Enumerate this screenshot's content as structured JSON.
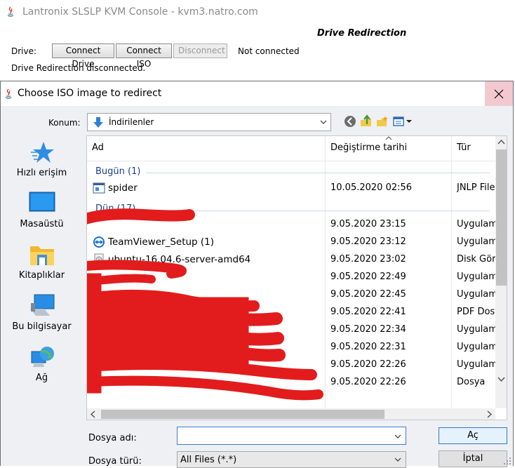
{
  "back_window": {
    "title": "Lantronix SLSLP KVM Console - kvm3.natro.com",
    "panel_title": "Drive Redirection",
    "drive_label": "Drive:",
    "buttons": {
      "connect_drive": "Connect Drive",
      "connect_iso": "Connect ISO",
      "disconnect": "Disconnect"
    },
    "connection_state": "Not connected",
    "status_message": "Drive Redirection disconnected."
  },
  "dialog": {
    "title": "Choose ISO image to redirect",
    "location_label": "Konum:",
    "location_value": "İndirilenler",
    "toolbar_icons": [
      "back-icon",
      "up-folder-icon",
      "new-folder-icon",
      "view-menu-icon"
    ],
    "places": [
      {
        "label": "Hızlı erişim",
        "icon": "quick-access-star-icon"
      },
      {
        "label": "Masaüstü",
        "icon": "desktop-icon"
      },
      {
        "label": "Kitaplıklar",
        "icon": "libraries-folder-icon"
      },
      {
        "label": "Bu bilgisayar",
        "icon": "computer-icon"
      },
      {
        "label": "Ağ",
        "icon": "network-globe-icon"
      }
    ],
    "columns": {
      "name": "Ad",
      "date": "Değiştirme tarihi",
      "type": "Tür"
    },
    "groups": {
      "today": "Bugün (1)",
      "yesterday": "Dün (17)"
    },
    "rows": [
      {
        "name": "spider",
        "date": "10.05.2020 02:56",
        "type": "JNLP File",
        "icon": "jnlp-file-icon"
      },
      {
        "name": "",
        "date": "9.05.2020 23:15",
        "type": "Uygulama",
        "icon": "redacted-file-icon"
      },
      {
        "name": "TeamViewer_Setup (1)",
        "date": "9.05.2020 23:12",
        "type": "Uygulama",
        "icon": "teamviewer-icon"
      },
      {
        "name": "ubuntu-16.04.6-server-amd64",
        "date": "9.05.2020 23:02",
        "type": "Disk Görüntüsü",
        "icon": "disk-image-icon"
      },
      {
        "name": "",
        "date": "9.05.2020 22:49",
        "type": "Uygulama",
        "icon": "redacted-file-icon"
      },
      {
        "name": "",
        "date": "9.05.2020 22:45",
        "type": "Uygulama",
        "icon": "redacted-file-icon"
      },
      {
        "name": "",
        "date": "9.05.2020 22:41",
        "type": "PDF Dosyası",
        "icon": "redacted-file-icon"
      },
      {
        "name": "",
        "date": "9.05.2020 22:34",
        "type": "Uygulama",
        "icon": "redacted-file-icon"
      },
      {
        "name": "",
        "date": "9.05.2020 22:31",
        "type": "Uygulama",
        "icon": "redacted-file-icon"
      },
      {
        "name": "",
        "date": "9.05.2020 22:26",
        "type": "Uygulama",
        "icon": "redacted-file-icon"
      },
      {
        "name": "",
        "date": "9.05.2020 22:26",
        "type": "Dosya",
        "icon": "redacted-file-icon"
      }
    ],
    "file_name_label": "Dosya adı:",
    "file_name_value": "",
    "file_type_label": "Dosya türü:",
    "file_type_value": "All Files (*.*)",
    "open_button": "Aç",
    "cancel_button": "İptal",
    "colors": {
      "group_header": "#1c3f8c",
      "close_hover": "#f3c8cf",
      "focus_border": "#3c7fd0",
      "redaction": "#e21c1c"
    }
  }
}
